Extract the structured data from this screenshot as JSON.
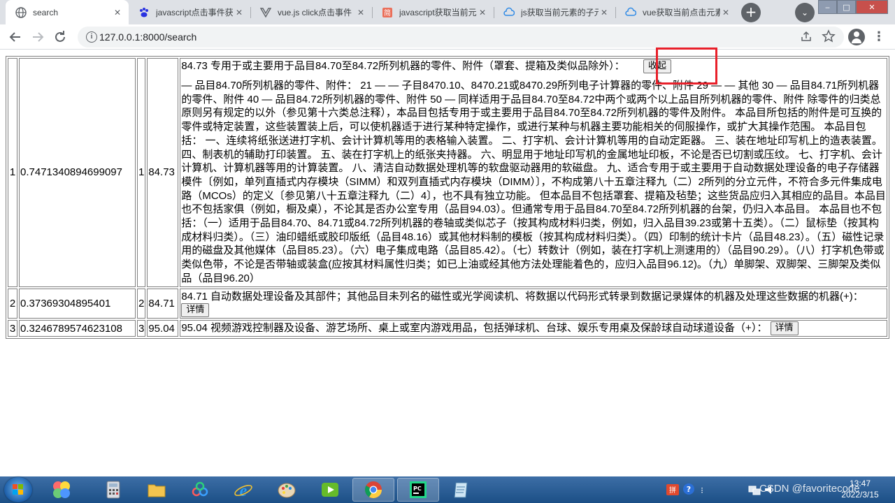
{
  "browser": {
    "tabs": [
      {
        "title": "search",
        "active": true,
        "icon": "globe-icon"
      },
      {
        "title": "javascript点击事件获",
        "active": false,
        "icon": "baidu-paw-icon"
      },
      {
        "title": "vue.js click点击事件",
        "active": false,
        "icon": "vue-logo-icon"
      },
      {
        "title": "javascript获取当前元",
        "active": false,
        "icon": "jianshu-icon"
      },
      {
        "title": "js获取当前元素的子元",
        "active": false,
        "icon": "cloud-icon"
      },
      {
        "title": "vue获取当前点击元素",
        "active": false,
        "icon": "cloud-icon"
      }
    ],
    "new_tab_label": "+",
    "tab_search_label": "⌄",
    "address": "127.0.0.1:8000/search",
    "window_controls": {
      "minimize": "‒",
      "maximize": "□",
      "close": "✕"
    }
  },
  "results": {
    "rows": [
      {
        "index": "1",
        "score": "0.7471340894699097",
        "rank": "1",
        "code": "84.73",
        "summary": "84.73 专用于或主要用于品目84.70至84.72所列机器的零件、附件（罩套、提箱及类似品除外）：",
        "button": "收起",
        "detail": "— 品目84.70所列机器的零件、附件： 21 — — 子目8470.10、8470.21或8470.29所列电子计算器的零件、附件 29 — — 其他 30 — 品目84.71所列机器的零件、附件 40 — 品目84.72所列机器的零件、附件 50 — 同样适用于品目84.70至84.72中两个或两个以上品目所列机器的零件、附件 除零件的归类总原则另有规定的以外（参见第十六类总注释），本品目包括专用于或主要用于品目84.70至84.72所列机器的零件及附件。 本品目所包括的附件是可互换的零件或特定装置，这些装置装上后，可以使机器适于进行某种特定操作，或进行某种与机器主要功能相关的伺服操作，或扩大其操作范围。 本品目包括： 一、连续将纸张送进打字机、会计计算机等用的表格输入装置。 二、打字机、会计计算机等用的自动定距器。 三、装在地址印写机上的造表装置。 四、制表机的辅助打印装置。 五、装在打字机上的纸张夹持器。 六、明显用于地址印写机的金属地址印板，不论是否已切割或压纹。 七、打字机、会计计算机、计算机器等用的计算装置。 八、清洁自动数据处理机等的软盘驱动器用的软磁盘。 九、适合专用于或主要用于自动数据处理设备的电子存储器模件〔例如，单列直插式内存模块（SIMM）和双列直插式内存模块（DIMM）〕，不构成第八十五章注释九（二）2所列的分立元件，不符合多元件集成电路（MCOs）的定义〔参见第八十五章注释九（二）4〕，也不具有独立功能。 但本品目不包括罩套、提箱及毡垫；这些货品应归入其相应的品目。本品目也不包括家俱（例如，橱及桌），不论其是否办公室专用（品目94.03）。但通常专用于品目84.70至84.72所列机器的台架，仍归入本品目。 本品目也不包括：（一）适用于品目84.70、84.71或84.72所列机器的卷轴或类似芯子（按其构成材料归类，例如，归入品目39.23或第十五类）。（二）鼠标垫（按其构成材料归类）。（三）油印蜡纸或胶印版纸（品目48.16）或其他材料制的模板（按其构成材料归类）。（四）印制的统计卡片（品目48.23）。（五）磁性记录用的磁盘及其他媒体（品目85.23）。（六）电子集成电路（品目85.42）。（七）转数计（例如，装在打字机上测速用的）（品目90.29）。（八）打字机色带或类似色带，不论是否带轴或装盒(应按其材料属性归类；如已上油或经其他方法处理能着色的，应归入品目96.12)。（九）单脚架、双脚架、三脚架及类似品（品目96.20）"
      },
      {
        "index": "2",
        "score": "0.37369304895401",
        "rank": "2",
        "code": "84.71",
        "summary": "84.71 自动数据处理设备及其部件；其他品目未列名的磁性或光学阅读机、将数据以代码形式转录到数据记录媒体的机器及处理这些数据的机器(+)：",
        "button": "详情",
        "detail": ""
      },
      {
        "index": "3",
        "score": "0.3246789574623108",
        "rank": "3",
        "code": "95.04",
        "summary": "95.04 视频游戏控制器及设备、游艺场所、桌上或室内游戏用品，包括弹球机、台球、娱乐专用桌及保龄球自动球道设备（+）：",
        "button": "详情",
        "detail": ""
      }
    ]
  },
  "annotation": {
    "color": "#e8202a"
  },
  "taskbar": {
    "clock_time": "13:47",
    "clock_date": "2022/3/15",
    "watermark": "CSDN @favoritecode"
  }
}
